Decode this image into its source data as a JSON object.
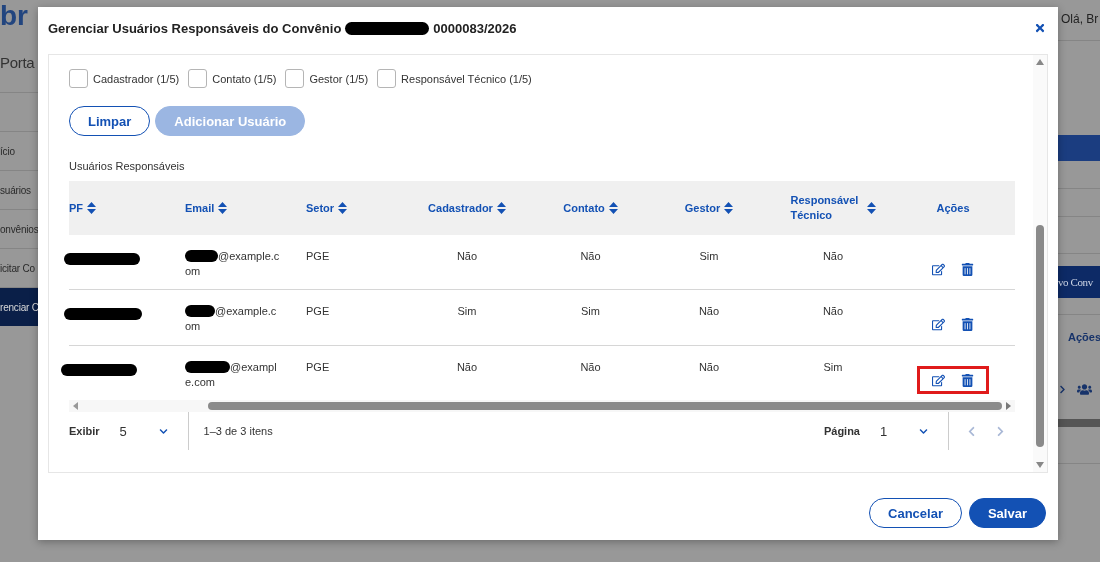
{
  "background": {
    "logo": "br",
    "portal_title": "Porta",
    "greeting": "Olá, Br",
    "sidebar_items": [
      {
        "label": "ício",
        "selected": false
      },
      {
        "label": "suários",
        "selected": false
      },
      {
        "label": "onvênios",
        "selected": false
      },
      {
        "label": "icitar Co",
        "selected": false
      },
      {
        "label": "renciar C",
        "selected": true
      }
    ],
    "new_button": "vo Conv",
    "column_header": "Ações"
  },
  "dialog": {
    "title": "Gerenciar Usuários Responsáveis do Convênio",
    "title_suffix": "0000083/2026"
  },
  "roles": [
    {
      "label": "Cadastrador (1/5)",
      "checked": false
    },
    {
      "label": "Contato (1/5)",
      "checked": false
    },
    {
      "label": "Gestor (1/5)",
      "checked": false
    },
    {
      "label": "Responsável Técnico (1/5)",
      "checked": false
    }
  ],
  "buttons": [
    {
      "label": "Limpar",
      "kind": "outline",
      "disabled": false
    },
    {
      "label": "Adicionar Usuário",
      "kind": "primary",
      "disabled": true
    }
  ],
  "table": {
    "caption": "Usuários Responsáveis",
    "columns": [
      {
        "label": "PF",
        "sortable": true
      },
      {
        "label": "Email",
        "sortable": true
      },
      {
        "label": "Setor",
        "sortable": true
      },
      {
        "label": "Cadastrador",
        "sortable": true
      },
      {
        "label": "Contato",
        "sortable": true
      },
      {
        "label": "Gestor",
        "sortable": true
      },
      {
        "label": "Responsável Técnico",
        "sortable": true
      },
      {
        "label": "Ações",
        "sortable": false
      }
    ],
    "rows": [
      {
        "email": "@example.com",
        "setor": "PGE",
        "cadastrador": "Não",
        "contato": "Não",
        "gestor": "Sim",
        "responsavel_tecnico": "Não",
        "highlighted": false
      },
      {
        "email": "@example.com",
        "setor": "PGE",
        "cadastrador": "Sim",
        "contato": "Sim",
        "gestor": "Não",
        "responsavel_tecnico": "Não",
        "highlighted": false
      },
      {
        "email": "@example.com",
        "setor": "PGE",
        "cadastrador": "Não",
        "contato": "Não",
        "gestor": "Não",
        "responsavel_tecnico": "Sim",
        "highlighted": true
      }
    ]
  },
  "pagination": {
    "label": "Exibir",
    "page_size": "5",
    "range": "1–3 de 3 itens",
    "page_label": "Página",
    "page": "1"
  },
  "footer_buttons": [
    {
      "label": "Cancelar",
      "kind": "outline"
    },
    {
      "label": "Salvar",
      "kind": "primary"
    }
  ]
}
